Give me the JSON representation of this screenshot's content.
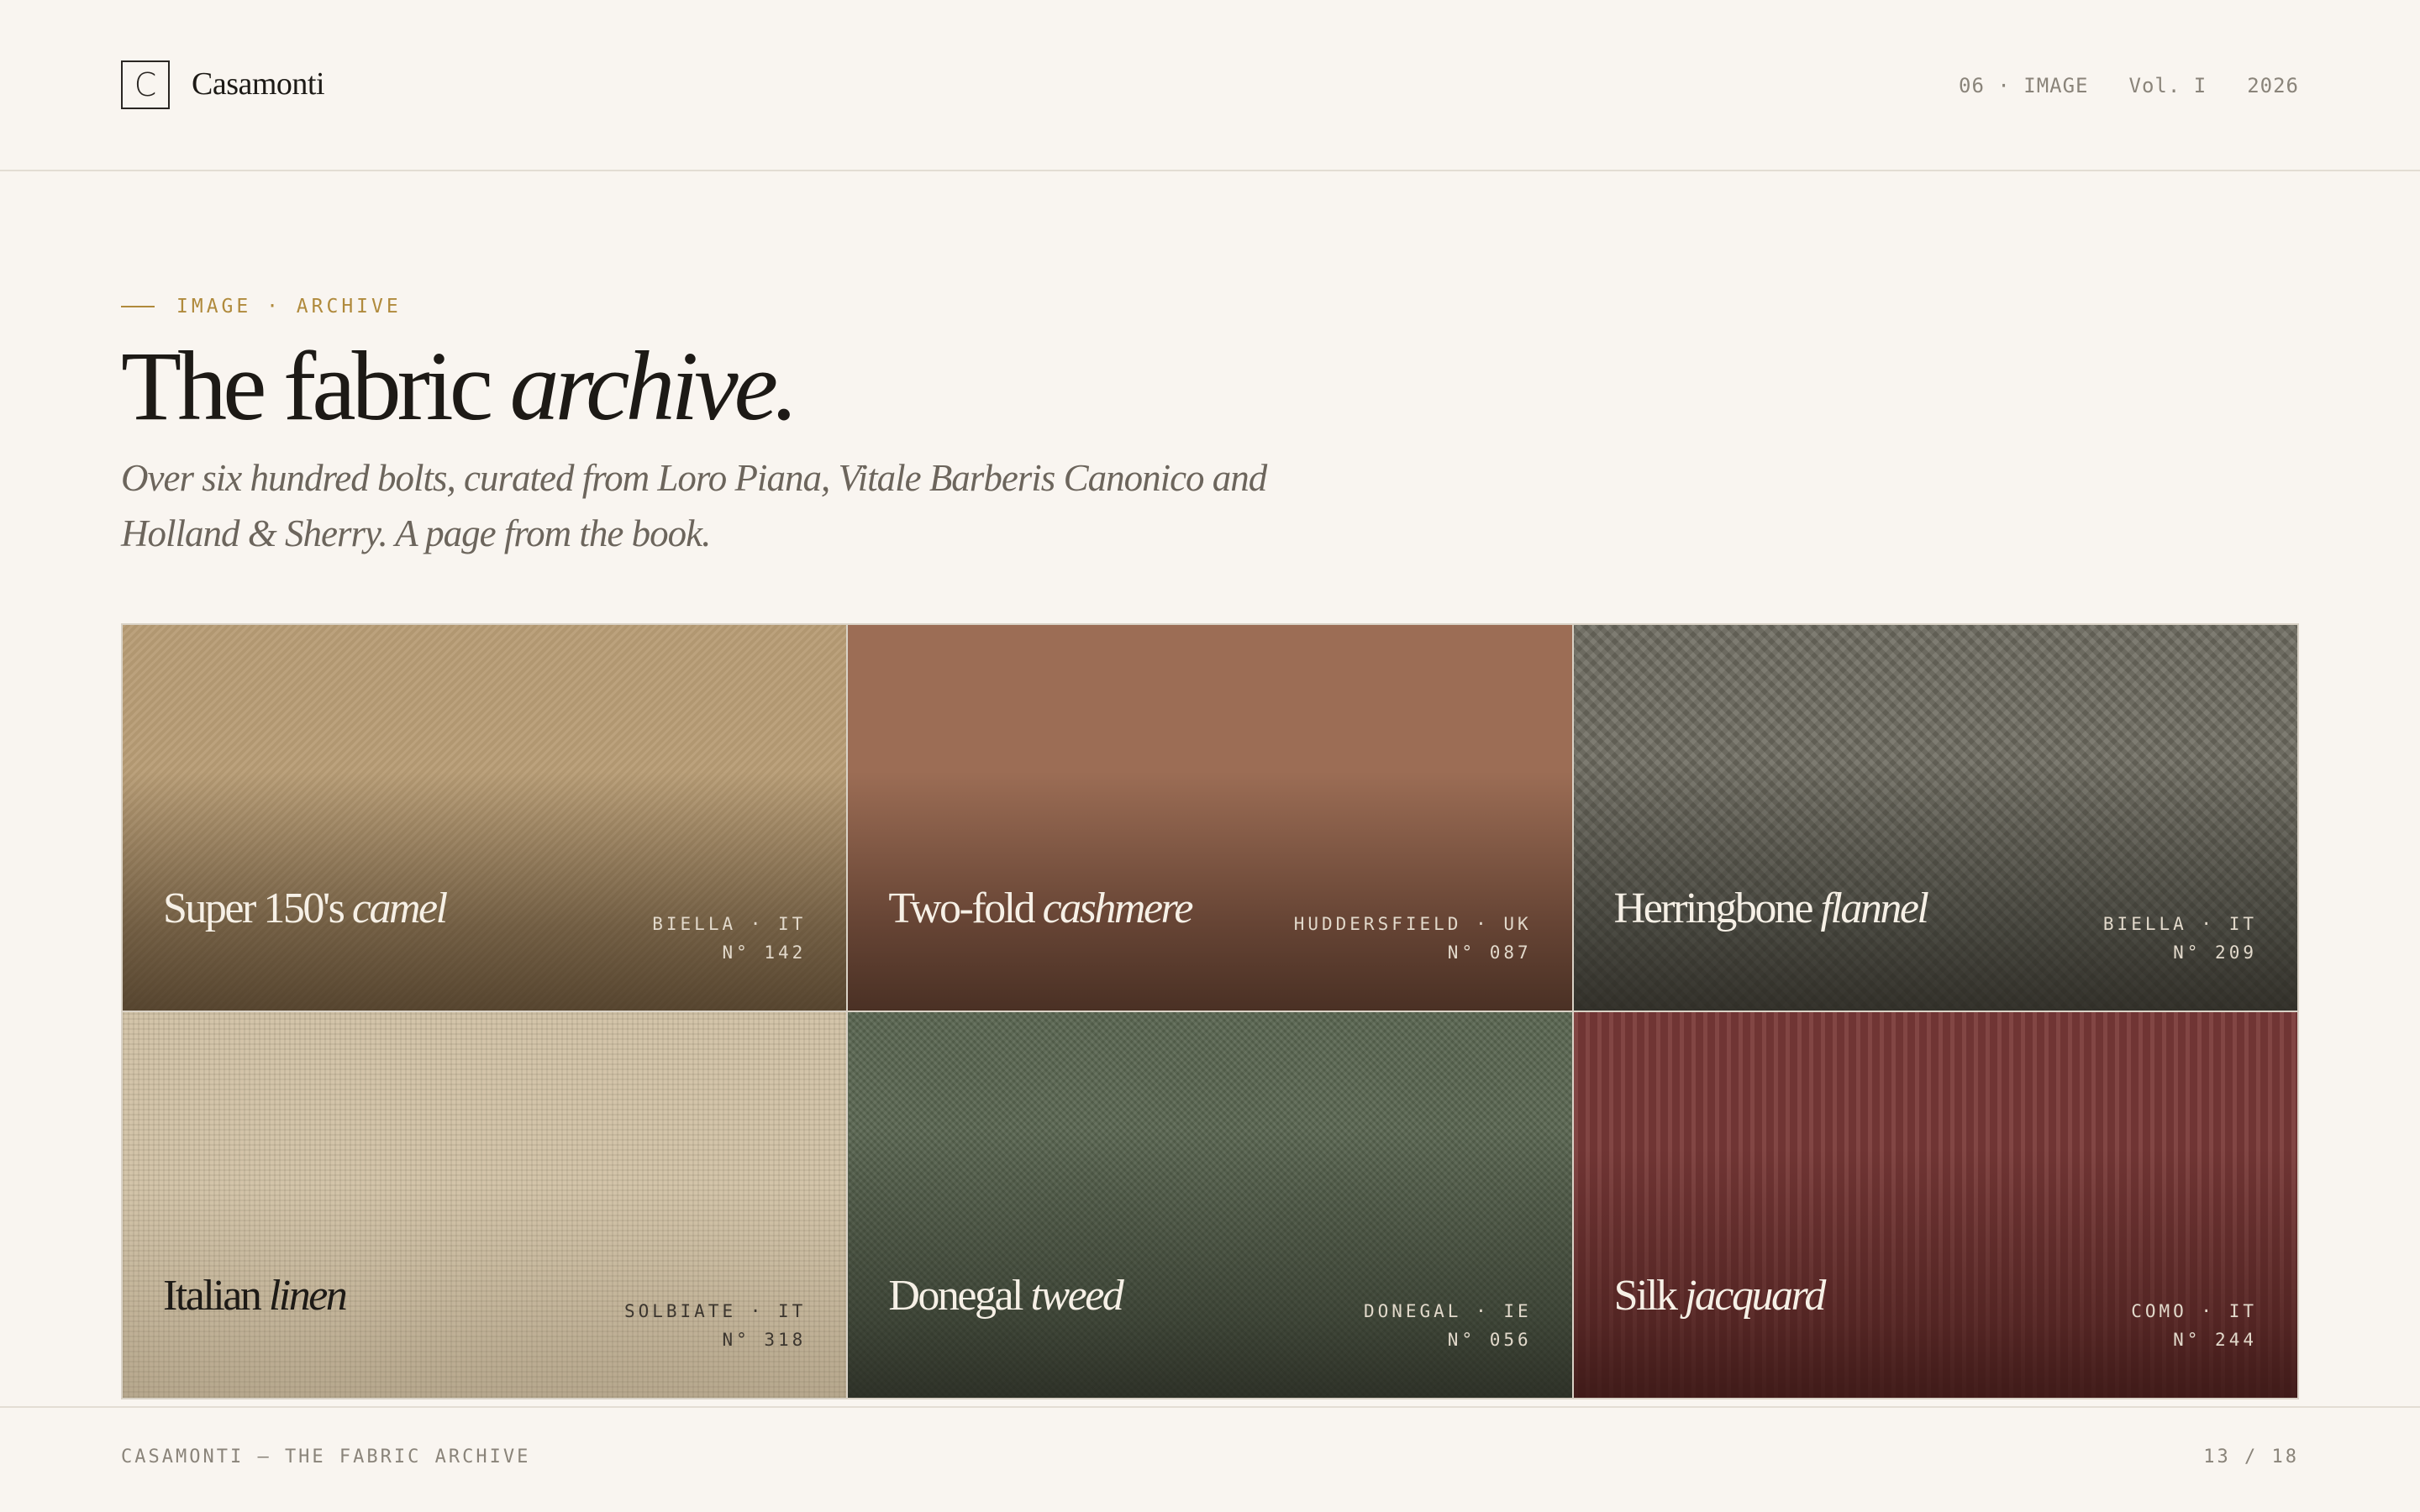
{
  "header": {
    "logo_letter": "C",
    "brand": "Casamonti",
    "section": "06 · IMAGE",
    "volume": "Vol. I",
    "year": "2026"
  },
  "hero": {
    "eyebrow": "IMAGE · ARCHIVE",
    "title_plain": "The fabric ",
    "title_italic": "archive.",
    "lede": "Over six hundred bolts, curated from Loro Piana, Vitale Barberis Canonico and Holland & Sherry. A page from the book."
  },
  "tiles": [
    {
      "name": "Super 150's ",
      "name_italic": "camel",
      "origin": "BIELLA · IT",
      "number": "N° 142",
      "color": "#b89d76"
    },
    {
      "name": "Two-fold ",
      "name_italic": "cashmere",
      "origin": "HUDDERSFIELD · UK",
      "number": "N° 087",
      "color": "#9c6d55"
    },
    {
      "name": "Herringbone ",
      "name_italic": "flannel",
      "origin": "BIELLA · IT",
      "number": "N° 209",
      "color": "#6d6a5f"
    },
    {
      "name": "Italian ",
      "name_italic": "linen",
      "origin": "SOLBIATE · IT",
      "number": "N° 318",
      "color": "#cfbfa2"
    },
    {
      "name": "Donegal ",
      "name_italic": "tweed",
      "origin": "DONEGAL · IE",
      "number": "N° 056",
      "color": "#5a6651"
    },
    {
      "name": "Silk ",
      "name_italic": "jacquard",
      "origin": "COMO · IT",
      "number": "N° 244",
      "color": "#7a3a38"
    }
  ],
  "footer": {
    "left": "CASAMONTI — THE FABRIC ARCHIVE",
    "page": "13 / 18"
  },
  "colors": {
    "background": "#f9f5f0",
    "accent": "#b08a3c",
    "ink": "#1d1a16",
    "muted": "#8a847a"
  }
}
